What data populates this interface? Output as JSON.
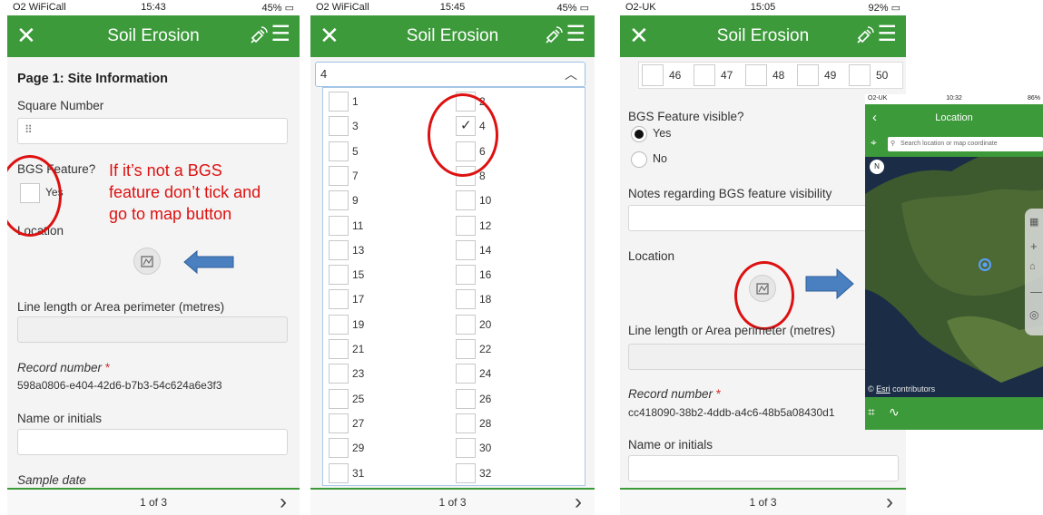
{
  "app": {
    "title": "Soil Erosion"
  },
  "phone1": {
    "status": {
      "carrier": "O2 WiFiCall",
      "time": "15:43",
      "battery": "45%"
    },
    "heading": "Page 1: Site Information",
    "square_label": "Square Number",
    "bgs_label": "BGS Feature?",
    "bgs_yes": "Yes",
    "location_label": "Location",
    "line_label": "Line length or Area perimeter (metres)",
    "record_label": "Record number",
    "record_value": "598a0806-e404-42d6-b7b3-54c624a6e3f3",
    "name_label": "Name or initials",
    "sample_label": "Sample date",
    "annotation": [
      "If it’s not a BGS",
      "feature don’t tick and",
      "go to map button"
    ],
    "footer_page": "1 of 3"
  },
  "phone2": {
    "status": {
      "carrier": "O2 WiFiCall",
      "time": "15:45",
      "battery": "45%"
    },
    "selected_value": "4",
    "left_numbers": [
      "1",
      "3",
      "5",
      "7",
      "9",
      "11",
      "13",
      "15",
      "17",
      "19",
      "21",
      "23",
      "25",
      "27",
      "29",
      "31"
    ],
    "right_numbers": [
      "2",
      "4",
      "6",
      "8",
      "10",
      "12",
      "14",
      "16",
      "18",
      "20",
      "22",
      "24",
      "26",
      "28",
      "30",
      "32"
    ],
    "footer_page": "1 of 3"
  },
  "phone3": {
    "status": {
      "carrier": "O2-UK",
      "time": "15:05",
      "battery": "92%"
    },
    "grid_numbers": [
      "46",
      "47",
      "48",
      "49",
      "50"
    ],
    "bgs_visible_label": "BGS Feature visible?",
    "yes": "Yes",
    "no": "No",
    "notes_label": "Notes regarding BGS feature visibility",
    "location_label": "Location",
    "line_label": "Line length or Area perimeter (metres)",
    "record_label": "Record number",
    "record_value": "cc418090-38b2-4ddb-a4c6-48b5a08430d1",
    "name_label": "Name or initials",
    "footer_page": "1 of 3"
  },
  "inset": {
    "status": {
      "carrier": "O2-UK",
      "time": "10:32",
      "battery": "86%"
    },
    "title": "Location",
    "search_placeholder": "Search location or map coordinate",
    "attribution_esri": "Esri",
    "attribution_rest": "contributors",
    "north": "N"
  },
  "required_mark": "*",
  "colors": {
    "brand_green": "#3c9a3a",
    "annotation_red": "#dd1111",
    "arrow_blue": "#4a7fc0"
  }
}
